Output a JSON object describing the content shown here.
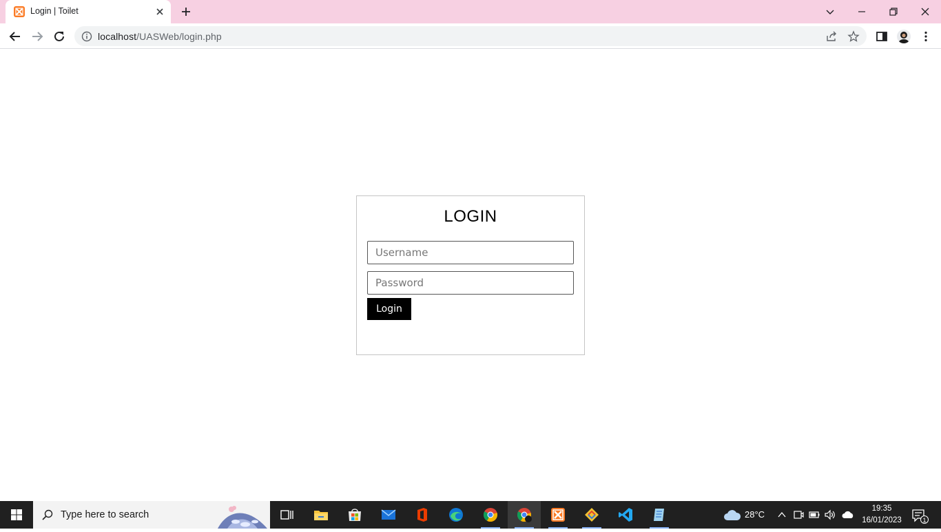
{
  "browser": {
    "tab_title": "Login | Toilet",
    "url_host": "localhost",
    "url_path": "/UASWeb/login.php"
  },
  "login": {
    "title": "LOGIN",
    "username_placeholder": "Username",
    "password_placeholder": "Password",
    "button_label": "Login"
  },
  "taskbar": {
    "search_placeholder": "Type here to search",
    "apps": [
      "task-view",
      "file-explorer",
      "microsoft-store",
      "mail",
      "office",
      "edge",
      "chrome",
      "chrome-profile",
      "xampp",
      "git",
      "vscode",
      "notepad"
    ],
    "weather": "28°C",
    "time": "19:35",
    "date": "16/01/2023",
    "notification_count": "1"
  },
  "colors": {
    "tabstrip": "#f7d0e2",
    "button_bg": "#000000",
    "taskbar": "#202020",
    "xampp_orange": "#fb7a24"
  }
}
